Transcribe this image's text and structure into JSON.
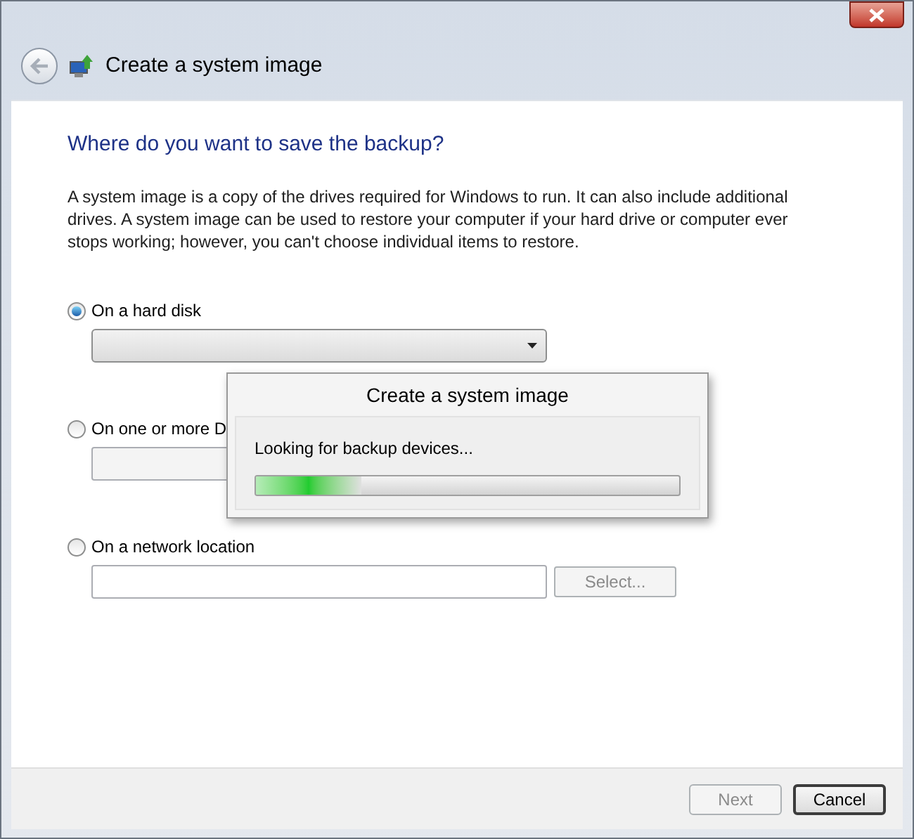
{
  "window": {
    "title": "Create a system image"
  },
  "heading": "Where do you want to save the backup?",
  "description": "A system image is a copy of the drives required for Windows to run. It can also include additional drives. A system image can be used to restore your computer if your hard drive or computer ever stops working; however, you can't choose individual items to restore.",
  "destinations": [
    {
      "kind": "dropdown",
      "label": "On a hard disk",
      "selected": true
    },
    {
      "kind": "field",
      "label": "On one or more D",
      "selected": false
    },
    {
      "kind": "field_with_button",
      "label": "On a network location",
      "selected": false,
      "button": {
        "label": "Select...",
        "disabled": true
      }
    }
  ],
  "progress_dialog": {
    "title": "Create a system image",
    "message": "Looking for backup devices...",
    "level": 0.25
  },
  "buttons": [
    {
      "label": "Next",
      "disabled": true
    },
    {
      "label": "Cancel",
      "disabled": false
    }
  ]
}
